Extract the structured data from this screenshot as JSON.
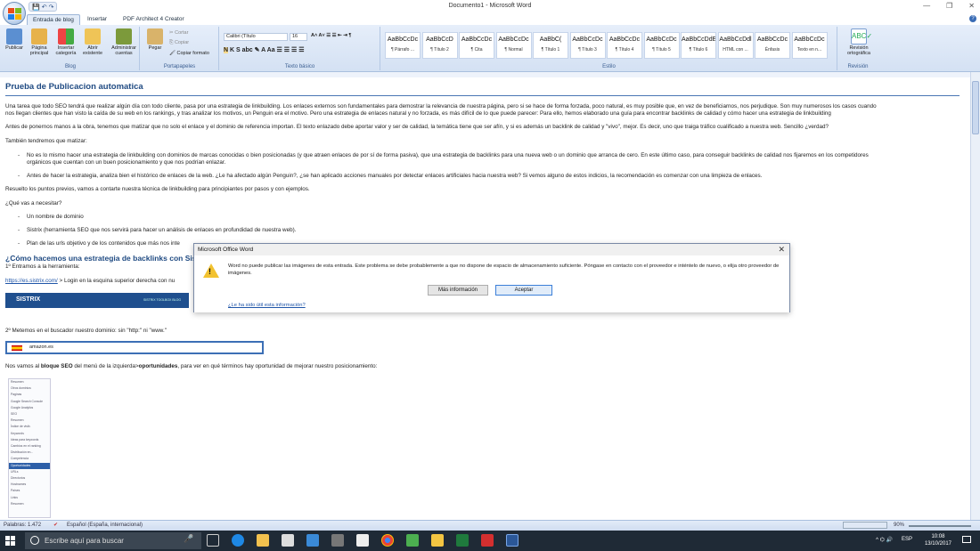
{
  "window": {
    "title": "Documento1 - Microsoft Word",
    "controls": [
      "—",
      "❐",
      "✕"
    ]
  },
  "qat": {
    "save": "💾",
    "undo": "↶",
    "redo": "↷"
  },
  "tabs": [
    "Entrada de blog",
    "Insertar",
    "PDF Architect 4 Creator"
  ],
  "ribbon": {
    "blog_buttons": [
      "Publicar",
      "Página principal",
      "Insertar categoría",
      "Abrir existente",
      "Administrar cuentas"
    ],
    "blog_group": "Blog",
    "clipboard": {
      "paste": "Pegar",
      "cut": "Cortar",
      "copy": "Copiar",
      "format": "Copiar formato",
      "group": "Portapapeles"
    },
    "font": {
      "name": "Calibri (Título",
      "size": "16",
      "group": "Texto básico"
    },
    "styles": [
      {
        "preview": "AaBbCcDc",
        "name": "¶ Párrafo ..."
      },
      {
        "preview": "AaBbCcD",
        "name": "¶ Título 2"
      },
      {
        "preview": "AaBbCcDc",
        "name": "¶ Cita"
      },
      {
        "preview": "AaBbCcDc",
        "name": "¶ Normal"
      },
      {
        "preview": "AaBbC(",
        "name": "¶ Título 1"
      },
      {
        "preview": "AaBbCcDc",
        "name": "¶ Título 3"
      },
      {
        "preview": "AaBbCcDc",
        "name": "¶ Título 4"
      },
      {
        "preview": "AaBbCcDc",
        "name": "¶ Título 5"
      },
      {
        "preview": "AaBbCcDdE",
        "name": "¶ Título 6"
      },
      {
        "preview": "AaBbCcDdl",
        "name": "HTML con ..."
      },
      {
        "preview": "AaBbCcDc",
        "name": "Énfasis"
      },
      {
        "preview": "AaBbCcDc",
        "name": "Texto en n..."
      }
    ],
    "styles_group": "Estilo",
    "spell": {
      "label": "Revisión ortográfica",
      "group": "Revisión"
    }
  },
  "document": {
    "heading": "Prueba de Publicacion automatica",
    "p1": "Una tarea que todo SEO tendrá que realizar algún día con todo cliente, pasa por una estrategia de linkbuilding. Los enlaces externos son fundamentales para demostrar la relevancia de nuestra página, pero si se hace de forma forzada, poco natural, es muy posible que, en vez de beneficiarnos, nos perjudique.  Son muy numerosos los casos cuando",
    "p1b": "nos llegan clientes que han visto la caída de su web en los rankings, y tras analizar los motivos, un Penguin era el motivo. Pero una estrategia de enlaces natural y no forzada, es más difícil de lo que puede parecer: Para ello, hemos elaborado una guía para encontrar backlinks de calidad  y cómo hacer una estrategia de linkbuilding",
    "p2": "Antes de ponernos manos a la obra, tenemos que matizar que no solo el enlace y el dominio de referencia importan.  El texto enlazado debe aportar valor y ser de calidad, la temática tiene que ser afín, y si es además un backlink de calidad y \"vivo\", mejor. Es decir, uno que traiga tráfico cualificado a nuestra web. Sencillo ¿verdad?",
    "p3": "También tendremos que matizar:",
    "b1": "No es lo mismo hacer una estrategia de linkbuilding con dominios de marcas conocidas o bien posicionadas (y que atraen enlaces de por sí de forma pasiva), que una estrategia de backlinks para una nueva web o un dominio que arranca de cero. En este último caso, para conseguir backlinks de calidad nos fijaremos en los competidores",
    "b1b": "orgánicos que cuentan con un buen posicionamiento y que nos podrían enlazar.",
    "b2": "Antes de hacer la estrategia, analiza bien el histórico de enlaces de la web. ¿Le ha afectado algún Penguin?, ¿se han aplicado acciones manuales por detectar enlaces artificiales hacia nuestra web? Si vemos alguno de estos indicios, la recomendación es comenzar con una limpieza de enlaces.",
    "p4": "Resuelto los puntos previos, vamos a contarte nuestra técnica de linkbuilding para principiantes por pasos y con ejemplos.",
    "p5": "¿Qué vas a necesitar?",
    "n1": "Un nombre de dominio",
    "n2": "Sistrix (herramienta SEO que nos servirá para hacer un análisis de enlaces en profundidad de nuestra web).",
    "n3": "Plan de las urls objetivo y de los contenidos que más nos inte",
    "h2": "¿Cómo hacemos una estrategia de backlinks con Sistri",
    "s1": "1º Entramos a la herramienta:",
    "s1link": "https://es.sistrix.com/",
    "s1rest": " > Login en la esquina superior derecha con nu",
    "sistrix_logo": "SISTRIX",
    "sistrix_nav": "SISTRIX TOOLBOX   BLOG",
    "s2": "2º Metemos en el buscador nuestro dominio: sin \"http:\" ni \"www.\"",
    "domain_input": "amazon.es",
    "s3a": "Nos vamos al ",
    "s3b": "bloque SEO",
    "s3c": " del menú de la izquierda>",
    "s3d": "oportunidades",
    "s3e": ", para ver en qué términos hay oportunidad de mejorar nuestro posicionamiento:",
    "menu_items": [
      "Resumen",
      "Otros dominios",
      "Paginas",
      "Google Search Console",
      "Google Analytics",
      "SEO",
      "Resumen",
      "Índice de visib.",
      "Keywords",
      "Ideas para keywords",
      "Cambios en el ranking",
      "Distribución en...",
      "Competencia",
      "Oportunidades",
      "URLs",
      "Directorios",
      "Hostnames",
      "Países",
      "Links",
      "Resumen"
    ]
  },
  "dialog": {
    "title": "Microsoft Office Word",
    "message": "Word no puede publicar las imágenes de esta entrada. Este problema se debe probablemente a que no dispone de espacio de almacenamiento suficiente. Póngase en contacto con el proveedor e inténtelo de nuevo, o elija otro proveedor de imágenes.",
    "more_info": "Más información",
    "accept": "Aceptar",
    "helpful": "¿Le ha sido útil esta información?"
  },
  "status": {
    "words": "Palabras: 1.472",
    "language": "Español (España, internacional)",
    "zoom": "90%"
  },
  "taskbar": {
    "search": "Escribe aquí para buscar",
    "lang": "ESP",
    "time": "10:08",
    "date": "13/10/2017"
  },
  "colors": {
    "accent": "#1f4a82",
    "ribbon": "#dbe6f5",
    "taskbar": "#1f2a36",
    "warning": "#f2c230"
  }
}
